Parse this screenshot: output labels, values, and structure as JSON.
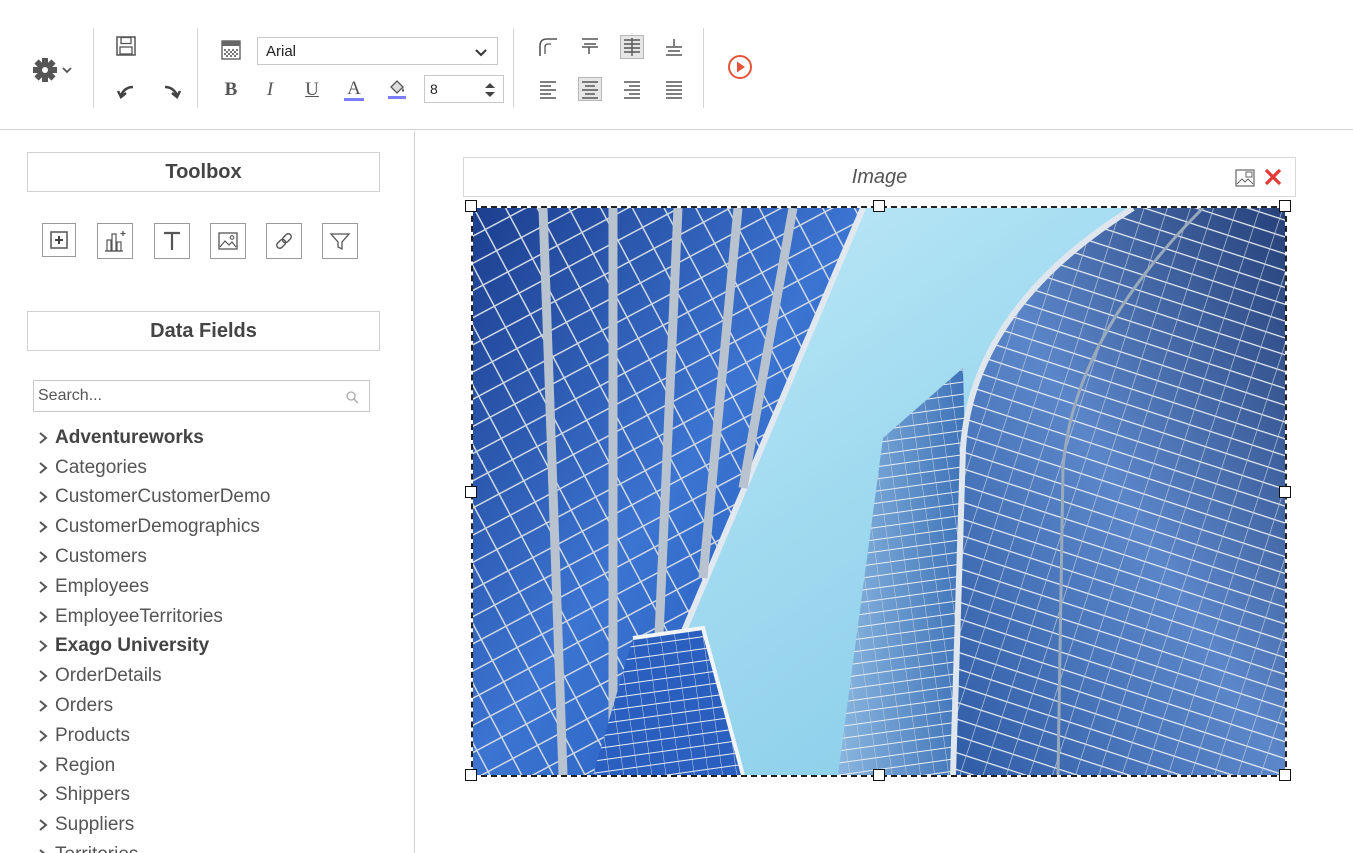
{
  "toolbar": {
    "settings_icon": "gear-icon",
    "font_family": "Arial",
    "font_size": "8",
    "buttons": {
      "bold": "B",
      "italic": "I",
      "underline": "U",
      "font_color": "A"
    },
    "active_alignment": "align-center",
    "active_vertical": "valign-middle"
  },
  "toolbox": {
    "title": "Toolbox",
    "tools": [
      "add-cell-icon",
      "chart-icon",
      "text-icon",
      "image-icon",
      "link-icon",
      "filter-icon"
    ]
  },
  "data_fields": {
    "title": "Data Fields",
    "search_placeholder": "Search...",
    "items": [
      {
        "label": "Adventureworks",
        "bold": true
      },
      {
        "label": "Categories",
        "bold": false
      },
      {
        "label": "CustomerCustomerDemo",
        "bold": false
      },
      {
        "label": "CustomerDemographics",
        "bold": false
      },
      {
        "label": "Customers",
        "bold": false
      },
      {
        "label": "Employees",
        "bold": false
      },
      {
        "label": "EmployeeTerritories",
        "bold": false
      },
      {
        "label": "Exago University",
        "bold": true
      },
      {
        "label": "OrderDetails",
        "bold": false
      },
      {
        "label": "Orders",
        "bold": false
      },
      {
        "label": "Products",
        "bold": false
      },
      {
        "label": "Region",
        "bold": false
      },
      {
        "label": "Shippers",
        "bold": false
      },
      {
        "label": "Suppliers",
        "bold": false
      },
      {
        "label": "Territories",
        "bold": false
      }
    ]
  },
  "canvas": {
    "image_panel_title": "Image",
    "colors": {
      "close": "#e53935",
      "sky": "#a6dcf0",
      "glass": "#3a72c8",
      "run": "#e5533a"
    }
  }
}
